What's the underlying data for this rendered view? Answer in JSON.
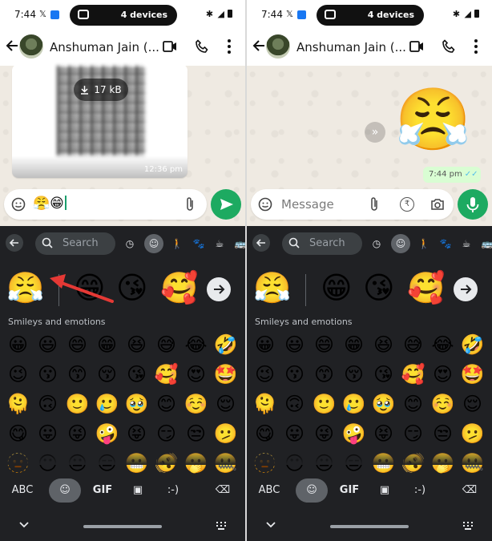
{
  "left": {
    "status": {
      "time": "7:44",
      "devices": "4 devices"
    },
    "header": {
      "contact_name": "Anshuman Jain (..."
    },
    "message": {
      "download_size": "17 kB",
      "time": "12:36 pm"
    },
    "input": {
      "text": "😤😁"
    },
    "keyboard": {
      "search_placeholder": "Search",
      "recent": [
        "😤",
        "😁",
        "😘",
        "🥰"
      ],
      "section_title": "Smileys and emotions",
      "emojis": [
        "😀",
        "😃",
        "😄",
        "😁",
        "😆",
        "😅",
        "😂",
        "🤣",
        "😉",
        "😗",
        "😙",
        "😚",
        "😘",
        "🥰",
        "😍",
        "🤩",
        "🫠",
        "🙃",
        "🙂",
        "🥲",
        "🥹",
        "😊",
        "☺️",
        "😌",
        "😋",
        "😛",
        "😜",
        "🤪",
        "😝",
        "😏",
        "😒",
        "🫤",
        "🫥",
        "😶",
        "😐",
        "😑",
        "😬",
        "🫨",
        "🫢",
        "🤐"
      ],
      "bottom": {
        "abc": "ABC",
        "gif": "GIF",
        "emoticon": ":-)"
      }
    }
  },
  "right": {
    "status": {
      "time": "7:44",
      "devices": "4 devices"
    },
    "header": {
      "contact_name": "Anshuman Jain (..."
    },
    "message": {
      "sticker": "😤",
      "time": "7:44 pm",
      "ticks": "✓✓"
    },
    "input": {
      "placeholder": "Message"
    },
    "keyboard": {
      "search_placeholder": "Search",
      "recent": [
        "😤",
        "😁",
        "😘",
        "🥰"
      ],
      "section_title": "Smileys and emotions",
      "emojis": [
        "😀",
        "😃",
        "😄",
        "😁",
        "😆",
        "😅",
        "😂",
        "🤣",
        "😉",
        "😗",
        "😙",
        "😚",
        "😘",
        "🥰",
        "😍",
        "🤩",
        "🫠",
        "🙃",
        "🙂",
        "🥲",
        "🥹",
        "😊",
        "☺️",
        "😌",
        "😋",
        "😛",
        "😜",
        "🤪",
        "😝",
        "😏",
        "😒",
        "🫤",
        "🫥",
        "😶",
        "😐",
        "😑",
        "😬",
        "🫨",
        "🫢",
        "🤐"
      ],
      "bottom": {
        "abc": "ABC",
        "gif": "GIF",
        "emoticon": ":-)"
      }
    }
  },
  "colors": {
    "whatsapp_green": "#1daa61",
    "keyboard_bg": "#202124",
    "annotation": "#e53935"
  }
}
